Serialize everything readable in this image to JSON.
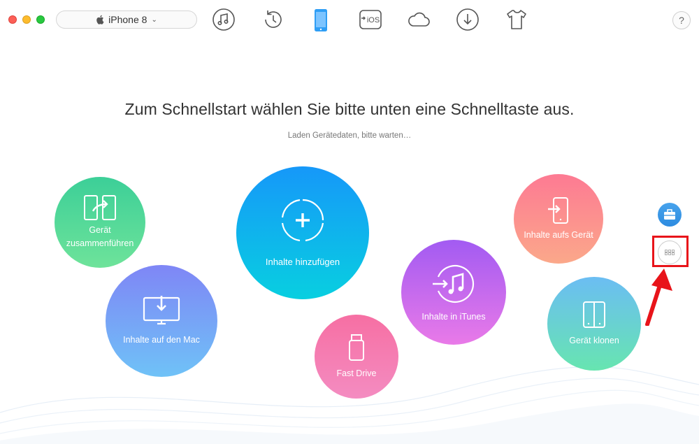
{
  "window": {
    "device_selector": {
      "label": "iPhone 8"
    },
    "toolbar": [
      {
        "name": "music-icon"
      },
      {
        "name": "history-icon"
      },
      {
        "name": "device-icon"
      },
      {
        "name": "ios-icon",
        "text": "iOS"
      },
      {
        "name": "cloud-icon"
      },
      {
        "name": "download-icon"
      },
      {
        "name": "shirt-icon"
      }
    ],
    "help_label": "?"
  },
  "main": {
    "headline": "Zum Schnellstart wählen Sie bitte unten eine Schnelltaste aus.",
    "status": "Laden Gerätedaten, bitte warten…",
    "actions": {
      "merge": {
        "label_line1": "Gerät",
        "label_line2": "zusammenführen",
        "icon": "merge-icon",
        "color": "#3ccf98"
      },
      "mac": {
        "label": "Inhalte auf den Mac",
        "icon": "monitor-download-icon",
        "color": "#7f86f6"
      },
      "add": {
        "label": "Inhalte hinzufügen",
        "icon": "add-icon",
        "color": "#1698f9"
      },
      "drive": {
        "label": "Fast Drive",
        "icon": "usb-drive-icon",
        "color": "#f66fa3"
      },
      "itunes": {
        "label": "Inhalte in iTunes",
        "icon": "itunes-icon",
        "color": "#a25bf2"
      },
      "to_device": {
        "label": "Inhalte aufs Gerät",
        "icon": "to-device-icon",
        "color": "#fd7a93"
      },
      "clone": {
        "label": "Gerät klonen",
        "icon": "clone-icon",
        "color": "#6bbdf3"
      }
    }
  },
  "side": {
    "toolkit": {
      "icon": "toolbox-icon",
      "color": "#2d8be0"
    },
    "more": {
      "icon": "more-grid-icon"
    },
    "annotation_color": "#e8141a"
  }
}
